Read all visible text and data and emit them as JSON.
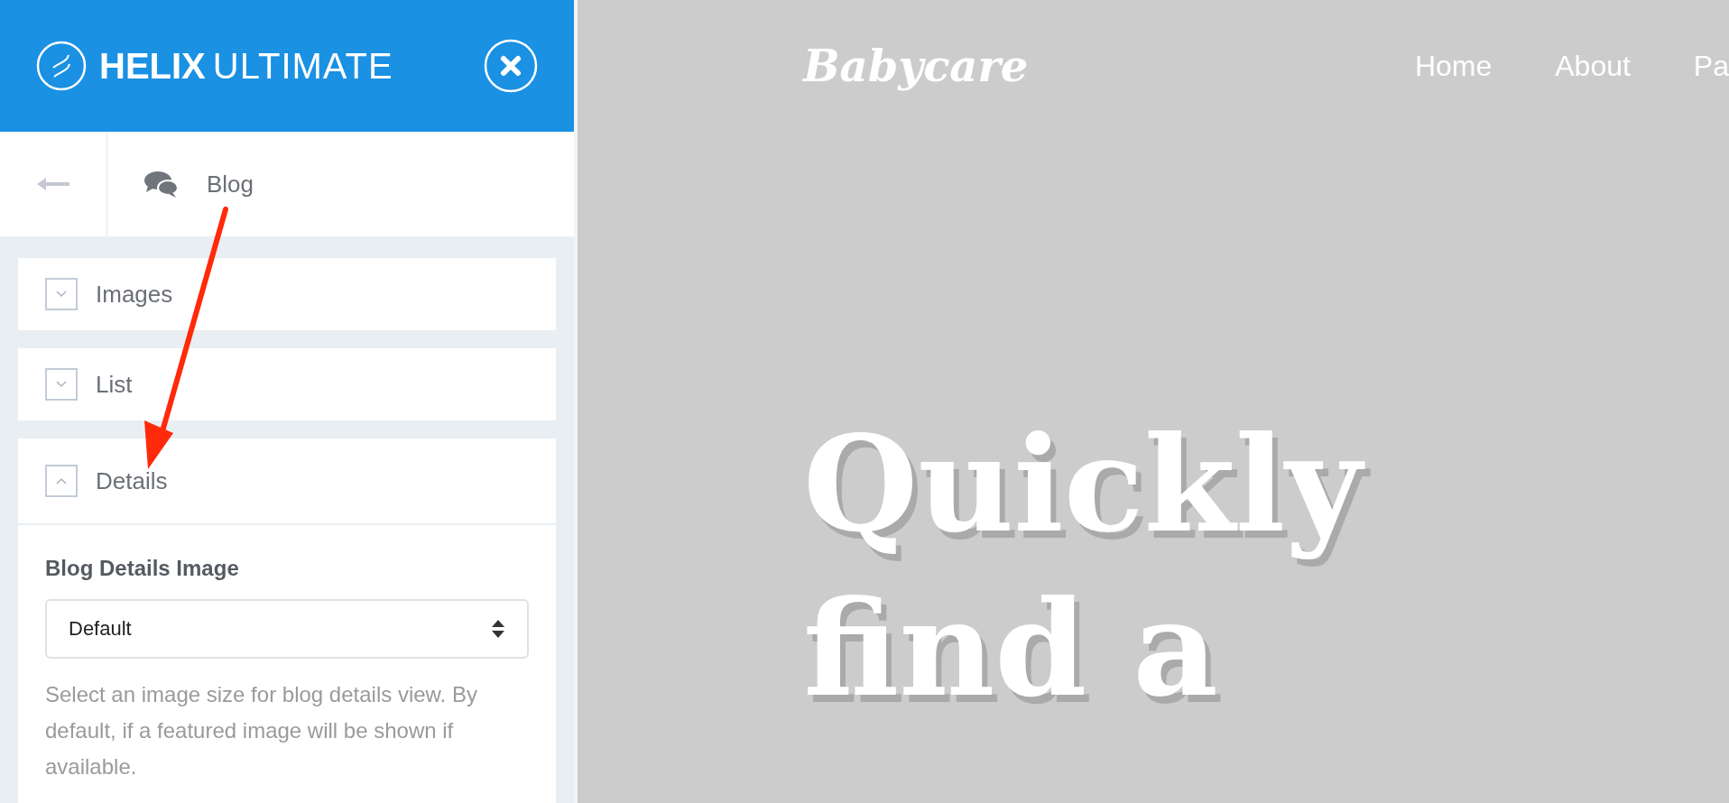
{
  "sidebar": {
    "brand": {
      "bold": "HELIX",
      "light": "ULTIMATE"
    },
    "crumb": {
      "label": "Blog"
    },
    "sections": [
      {
        "label": "Images",
        "expanded": false
      },
      {
        "label": "List",
        "expanded": false
      },
      {
        "label": "Details",
        "expanded": true
      }
    ],
    "details": {
      "field_label": "Blog Details Image",
      "select": {
        "value": "Default"
      },
      "help": "Select an image size for blog details view. By default, if a featured image will be shown if available."
    }
  },
  "site": {
    "logo": "Babycare",
    "nav": [
      {
        "label": "Home"
      },
      {
        "label": "About"
      },
      {
        "label": "Pa"
      }
    ],
    "hero_lines": [
      "Quickly",
      "find a"
    ]
  }
}
